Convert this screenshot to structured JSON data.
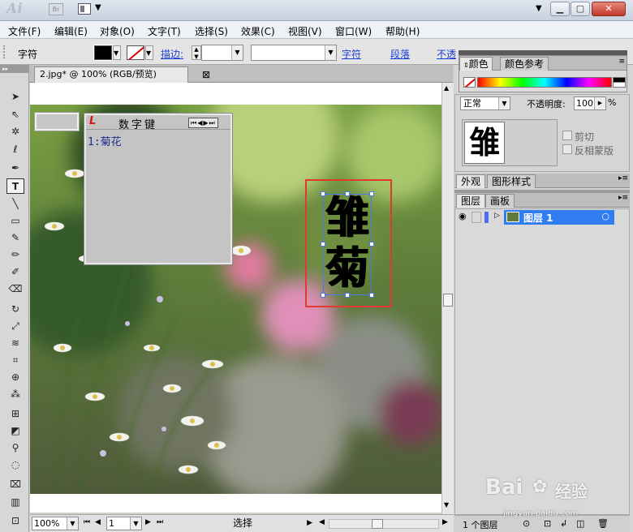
{
  "app": {
    "logo": "Ai",
    "bridge": "Br"
  },
  "window_buttons": {
    "minimize": "▭",
    "restore": "▭",
    "close": "✕"
  },
  "menu": [
    "文件(F)",
    "编辑(E)",
    "对象(O)",
    "文字(T)",
    "选择(S)",
    "效果(C)",
    "视图(V)",
    "窗口(W)",
    "帮助(H)"
  ],
  "control": {
    "label": "字符",
    "stroke_label": "描边:",
    "links": [
      "字符",
      "段落",
      "不透"
    ]
  },
  "document": {
    "tab_title": "2.jpg* @ 100% (RGB/预览)",
    "close": "⊠"
  },
  "num_panel": {
    "title": "数字键",
    "entry": "1:菊花",
    "nav": "⏮◀▶⏭"
  },
  "artwork": {
    "chars": [
      "雏",
      "菊"
    ]
  },
  "color_panel": {
    "tabs": [
      "颜色",
      "颜色参考"
    ]
  },
  "transparency": {
    "mode": "正常",
    "opacity_label": "不透明度:",
    "opacity_value": "100",
    "unit": "%",
    "clip": "剪切",
    "invert": "反相蒙版",
    "thumb": "雏"
  },
  "appearance_tabs": [
    "外观",
    "图形样式"
  ],
  "layers_tabs": [
    "图层",
    "画板"
  ],
  "layer": {
    "name": "图层 1",
    "count": "1 个图层"
  },
  "status": {
    "zoom": "100%",
    "page": "1",
    "mode": "选择"
  },
  "watermark": {
    "brand": "Bai",
    "brand2": "经验",
    "url": "jingyan.baidu.com"
  }
}
